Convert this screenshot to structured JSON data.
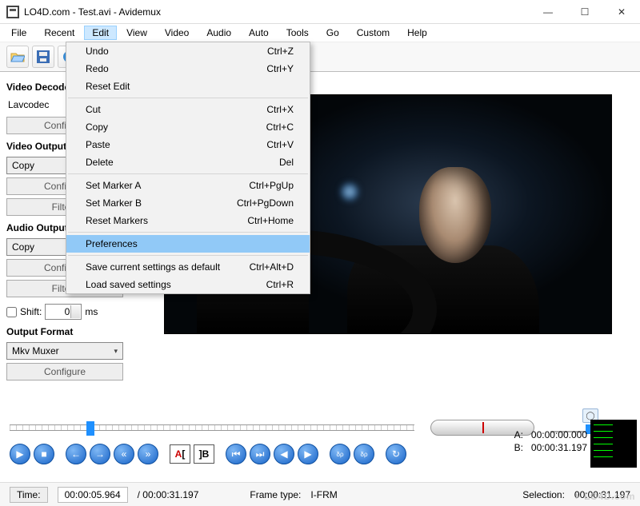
{
  "window": {
    "title": "LO4D.com - Test.avi - Avidemux"
  },
  "menubar": [
    "File",
    "Recent",
    "Edit",
    "View",
    "Video",
    "Audio",
    "Auto",
    "Tools",
    "Go",
    "Custom",
    "Help"
  ],
  "active_menu_index": 2,
  "edit_menu": {
    "groups": [
      [
        {
          "label": "Undo",
          "accel": "Ctrl+Z"
        },
        {
          "label": "Redo",
          "accel": "Ctrl+Y"
        },
        {
          "label": "Reset Edit",
          "accel": ""
        }
      ],
      [
        {
          "label": "Cut",
          "accel": "Ctrl+X"
        },
        {
          "label": "Copy",
          "accel": "Ctrl+C"
        },
        {
          "label": "Paste",
          "accel": "Ctrl+V"
        },
        {
          "label": "Delete",
          "accel": "Del"
        }
      ],
      [
        {
          "label": "Set Marker A",
          "accel": "Ctrl+PgUp"
        },
        {
          "label": "Set Marker B",
          "accel": "Ctrl+PgDown"
        },
        {
          "label": "Reset Markers",
          "accel": "Ctrl+Home"
        }
      ],
      [
        {
          "label": "Preferences",
          "accel": "",
          "highlight": true
        }
      ],
      [
        {
          "label": "Save current settings as default",
          "accel": "Ctrl+Alt+D"
        },
        {
          "label": "Load saved settings",
          "accel": "Ctrl+R"
        }
      ]
    ]
  },
  "sidebar": {
    "video_decoder": {
      "label": "Video Decoder",
      "value": "Lavcodec",
      "configure": "Configure"
    },
    "video_output": {
      "label": "Video Output",
      "value": "Copy",
      "configure": "Configure",
      "filters": "Filters"
    },
    "audio_output": {
      "label": "Audio Output",
      "value": "Copy",
      "configure": "Configure",
      "filters": "Filters"
    },
    "shift": {
      "label": "Shift:",
      "value": "0",
      "unit": "ms"
    },
    "output_format": {
      "label": "Output Format",
      "value": "Mkv Muxer",
      "configure": "Configure"
    }
  },
  "timecodes": {
    "a_label": "A:",
    "a": "00:00:00.000",
    "b_label": "B:",
    "b": "00:00:31.197",
    "time_label": "Time:",
    "time": "00:00:05.964",
    "duration": "/ 00:00:31.197",
    "frame_label": "Frame type:",
    "frame": "I-FRM",
    "selection_label": "Selection:",
    "selection": "00:00:31.197"
  },
  "watermark": {
    "brand": "LO4",
    "suffix": "D.com"
  },
  "icons": {
    "open": "open",
    "save": "save",
    "info": "info",
    "calc": "calc",
    "play": "▶",
    "stop": "■",
    "next": "➔",
    "prev": "⬅",
    "ff": "»",
    "rw": "«",
    "step_back": "◀",
    "step_fwd": "▶",
    "first": "⏮",
    "last": "⏭",
    "loop": "↻"
  }
}
